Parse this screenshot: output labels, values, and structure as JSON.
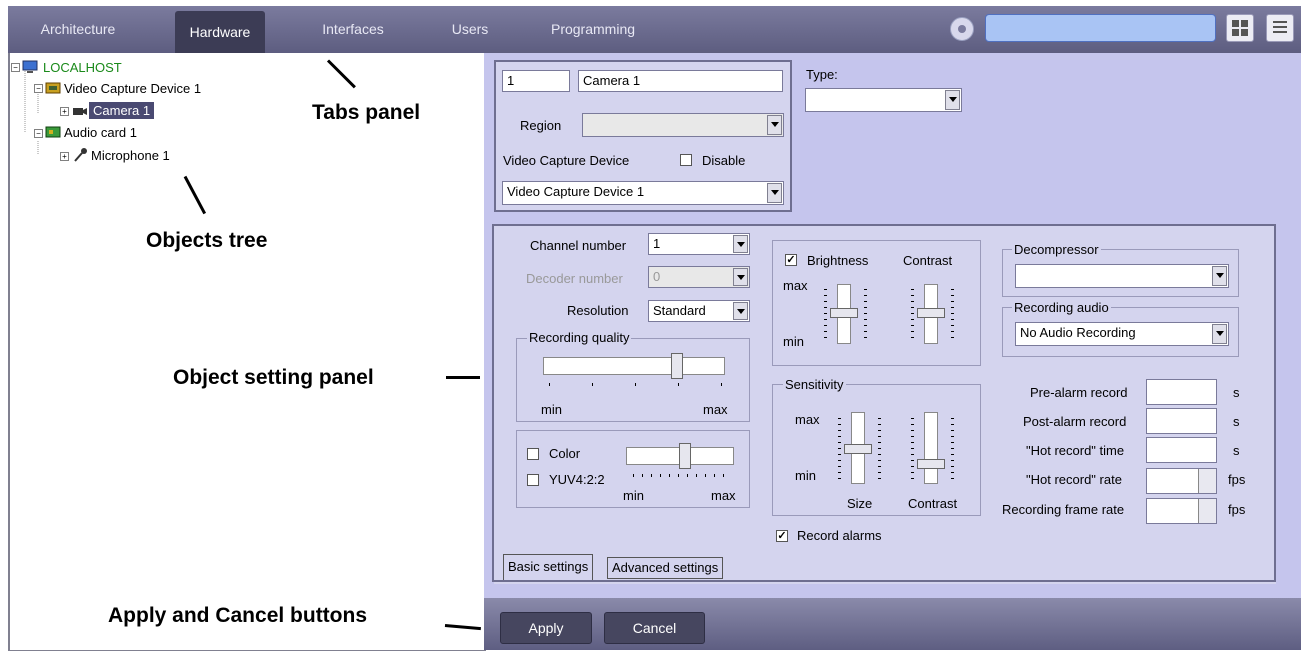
{
  "tabs": [
    "Architecture",
    "Hardware",
    "Interfaces",
    "Users",
    "Programming"
  ],
  "active_tab": "Hardware",
  "tree": {
    "root": "LOCALHOST",
    "video_device": "Video Capture Device 1",
    "camera": "Camera 1",
    "audio_card": "Audio card 1",
    "microphone": "Microphone 1"
  },
  "annotations": {
    "tabs_panel": "Tabs panel",
    "objects_tree": "Objects tree",
    "object_setting_panel": "Object setting panel",
    "apply_cancel": "Apply and Cancel buttons"
  },
  "camera_header": {
    "id": "1",
    "name": "Camera 1",
    "type_label": "Type:",
    "type_value": "",
    "region_label": "Region",
    "region_value": "",
    "vcd_label": "Video Capture Device",
    "disable_label": "Disable",
    "disable_checked": false,
    "vcd_value": "Video Capture Device 1"
  },
  "basic": {
    "channel_label": "Channel number",
    "channel_value": "1",
    "decoder_label": "Decoder number",
    "decoder_value": "0",
    "resolution_label": "Resolution",
    "resolution_value": "Standard",
    "recq_label": "Recording quality",
    "recq_min": "min",
    "recq_max": "max",
    "recq_level": 0.75,
    "color_label": "Color",
    "yuv_label": "YUV4:2:2",
    "color_min": "min",
    "color_max": "max",
    "color_level": 0.55,
    "brightness_label": "Brightness",
    "brightness_checked": true,
    "contrast_label": "Contrast",
    "bc_max": "max",
    "bc_min": "min",
    "sensitivity_label": "Sensitivity",
    "sens_max": "max",
    "sens_min": "min",
    "size_label": "Size",
    "contrast2_label": "Contrast",
    "record_alarms_label": "Record alarms",
    "record_alarms_checked": true,
    "decompressor_label": "Decompressor",
    "decompressor_value": "",
    "rec_audio_label": "Recording audio",
    "rec_audio_value": "No Audio Recording",
    "prealarm_label": "Pre-alarm record",
    "postalarm_label": "Post-alarm record",
    "hot_time_label": "\"Hot record\" time",
    "hot_rate_label": "\"Hot record\" rate",
    "frame_rate_label": "Recording frame rate",
    "unit_s": "s",
    "unit_fps": "fps"
  },
  "settings_tabs": [
    "Basic settings",
    "Advanced settings"
  ],
  "buttons": {
    "apply": "Apply",
    "cancel": "Cancel"
  },
  "colors": {
    "accent": "#5d5d80",
    "panel": "#c5c5ed",
    "search": "#a9c4f4"
  }
}
